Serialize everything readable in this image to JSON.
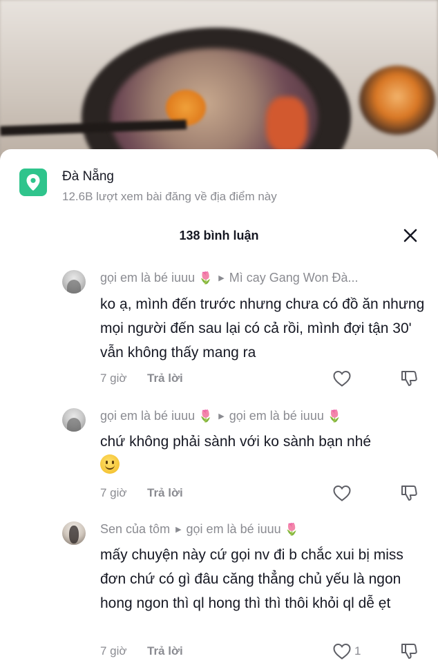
{
  "location": {
    "name": "Đà Nẵng",
    "views": "12.6B lượt xem bài đăng về địa điểm này",
    "icon": "location-pin-icon",
    "accent": "#2fc48c"
  },
  "comments_header": {
    "count_label": "138 bình luận",
    "close_icon": "close-icon"
  },
  "comments": [
    {
      "author": "gọi em là bé iuuu",
      "author_emoji": "🌷",
      "reply_to": "Mì cay Gang Won Đà...",
      "text": "ko ạ, mình đến trước nhưng chưa có đồ ăn nhưng mọi người đến sau lại có cả rồi, mình đợi tận 30' vẫn không thấy mang ra",
      "time": "7 giờ",
      "reply_label": "Trả lời",
      "likes": ""
    },
    {
      "author": "gọi em là bé iuuu",
      "author_emoji": "🌷",
      "reply_to": "gọi em là bé iuuu",
      "reply_to_emoji": "🌷",
      "text": "chứ không phải sành với ko sành bạn nhé",
      "time": "7 giờ",
      "reply_label": "Trả lời",
      "likes": ""
    },
    {
      "author": "Sen của tôm",
      "reply_to": "gọi em là bé iuuu",
      "reply_to_emoji": "🌷",
      "text": "mấy chuyện này cứ gọi nv đi b chắc xui bị miss đơn chứ có gì đâu căng thẳng chủ yếu là ngon hong ngon thì ql hong thì thì thôi khỏi ql dễ ẹt",
      "time": "7 giờ",
      "reply_label": "Trả lời",
      "likes": "1"
    }
  ]
}
